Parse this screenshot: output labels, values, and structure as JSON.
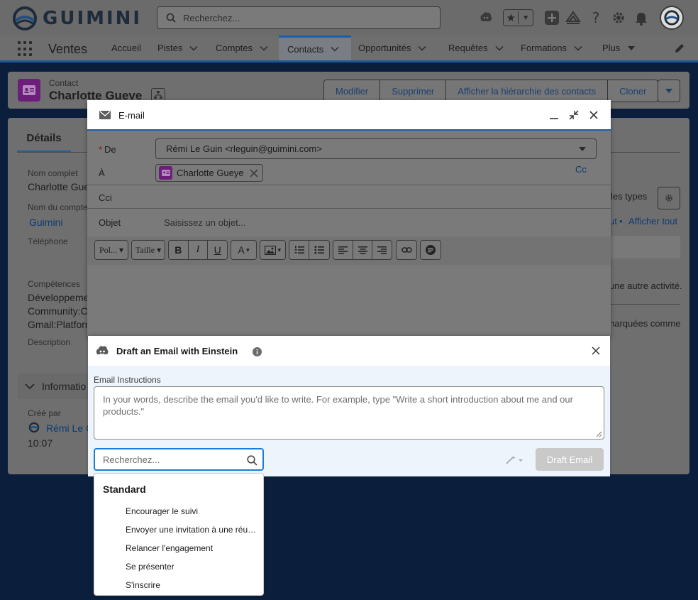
{
  "header": {
    "logo_text": "GUIMINI",
    "search_placeholder": "Recherchez..."
  },
  "nav": {
    "app_name": "Ventes",
    "items": [
      {
        "label": "Accueil",
        "has_menu": false
      },
      {
        "label": "Pistes",
        "has_menu": true
      },
      {
        "label": "Comptes",
        "has_menu": true
      },
      {
        "label": "Contacts",
        "has_menu": true,
        "active": true
      },
      {
        "label": "Opportunités",
        "has_menu": true
      },
      {
        "label": "Requêtes",
        "has_menu": true
      },
      {
        "label": "Formations",
        "has_menu": true
      },
      {
        "label": "Plus",
        "has_menu": true
      }
    ]
  },
  "record": {
    "type": "Contact",
    "name": "Charlotte Gueve",
    "actions": [
      "Modifier",
      "Supprimer",
      "Afficher la hiérarchie des contacts",
      "Cloner"
    ]
  },
  "details": {
    "tab_label": "Détails",
    "full_name_label": "Nom complet",
    "full_name_value": "Charlotte Gue",
    "account_label": "Nom du compte",
    "account_value": "Guimini",
    "phone_label": "Téléphone",
    "skills_label": "Compétences",
    "skills_values": [
      "Développeme",
      "Community:C",
      "Gmail:Platforn"
    ],
    "description_label": "Description",
    "info_section": "Informatio",
    "created_by_label": "Créé par",
    "created_by_value": "Rémi Le C",
    "created_time": "10:07"
  },
  "activity": {
    "filter_text": "les types",
    "expand_text_1": "ut",
    "bullet": "•",
    "expand_text_2": "Afficher tout",
    "no_activity": "une autre activité.",
    "marked_as": "narquées comme"
  },
  "email": {
    "title": "E-mail",
    "required_mark": "*",
    "from_label": "De",
    "from_value": "Rémi Le Guin <rleguin@guimini.com>",
    "to_label": "À",
    "to_value": "Charlotte Gueye",
    "cc_label": "Cc",
    "bcc_label": "Cci",
    "subject_label": "Objet",
    "subject_placeholder": "Saisissez un objet...",
    "toolbar": {
      "font": "Pol...",
      "size": "Taille"
    }
  },
  "einstein": {
    "title": "Draft an Email with Einstein",
    "instructions_label": "Email Instructions",
    "instructions_placeholder": "In your words, describe the email you'd like to write. For example, type \"Write a short introduction about me and our products.\"",
    "search_placeholder": "Recherchez...",
    "draft_button": "Draft Email"
  },
  "templates": {
    "group": "Standard",
    "items": [
      "Encourager le suivi",
      "Envoyer une invitation à une réunion",
      "Relancer l'engagement",
      "Se présenter",
      "S'inscrire"
    ]
  }
}
